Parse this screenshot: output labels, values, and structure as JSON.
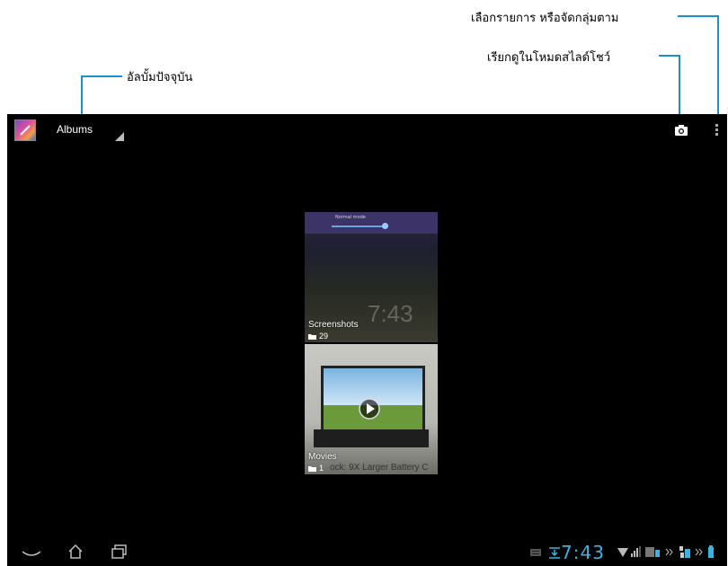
{
  "callouts": {
    "current_album": "อัลบั้มปัจจุบัน",
    "slideshow": "เรียกดูในโหมดสไลด์โชว์",
    "select_group": "เลือกรายการ หรือจัดกลุ่มตาม"
  },
  "actionbar": {
    "title": "Albums"
  },
  "albums": [
    {
      "name": "Screenshots",
      "count": "29"
    },
    {
      "name": "Movies",
      "count": "1"
    }
  ],
  "screenshot_card": {
    "mode_text": "Normal mode"
  },
  "movie_card": {
    "caption": "ock: 9X Larger Battery C"
  },
  "statusbar": {
    "time": "7:43"
  },
  "colors": {
    "accent": "#33b5e5",
    "callout_line": "#1a8fd6",
    "screen_bg": "#000000"
  },
  "icons": [
    "gallery-app-icon",
    "dropdown-arrow-icon",
    "camera-icon",
    "overflow-menu-icon",
    "back-icon",
    "home-icon",
    "recent-apps-icon",
    "folder-icon",
    "play-icon",
    "keyboard-icon",
    "sd-icon",
    "wifi-icon",
    "signal-icon",
    "battery-icon",
    "usb-icon"
  ]
}
